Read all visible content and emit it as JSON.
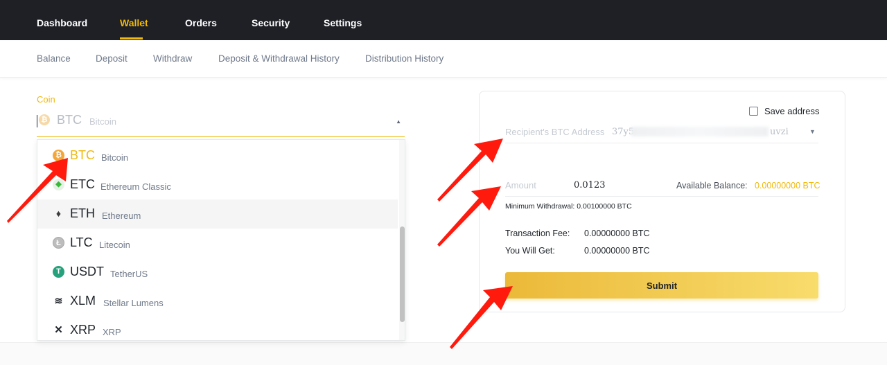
{
  "topnav": {
    "items": [
      {
        "label": "Dashboard"
      },
      {
        "label": "Wallet"
      },
      {
        "label": "Orders"
      },
      {
        "label": "Security"
      },
      {
        "label": "Settings"
      }
    ],
    "active": "Wallet"
  },
  "subnav": {
    "items": [
      {
        "label": "Balance"
      },
      {
        "label": "Deposit"
      },
      {
        "label": "Withdraw"
      },
      {
        "label": "Deposit & Withdrawal History"
      },
      {
        "label": "Distribution History"
      }
    ]
  },
  "coin_select": {
    "label": "Coin",
    "selected_symbol": "BTC",
    "selected_name": "Bitcoin",
    "selected_icon": "bitcoin-icon"
  },
  "dropdown": {
    "items": [
      {
        "symbol": "BTC",
        "name": "Bitcoin",
        "icon": "bitcoin-icon",
        "selected": true
      },
      {
        "symbol": "ETC",
        "name": "Ethereum Classic",
        "icon": "ethereum-classic-icon"
      },
      {
        "symbol": "ETH",
        "name": "Ethereum",
        "icon": "ethereum-icon",
        "hovered": true
      },
      {
        "symbol": "LTC",
        "name": "Litecoin",
        "icon": "litecoin-icon"
      },
      {
        "symbol": "USDT",
        "name": "TetherUS",
        "icon": "tether-icon"
      },
      {
        "symbol": "XLM",
        "name": "Stellar Lumens",
        "icon": "stellar-icon"
      },
      {
        "symbol": "XRP",
        "name": "XRP",
        "icon": "xrp-icon"
      }
    ]
  },
  "form": {
    "save_address": "Save address",
    "address_label": "Recipient's BTC Address",
    "address_value_start": "37y5",
    "address_value_end": "uvzi",
    "amount_label": "Amount",
    "amount_value": "0.0123",
    "available_label": "Available Balance:",
    "available_value": "0.00000000 BTC",
    "min_withdrawal": "Minimum Withdrawal: 0.00100000 BTC",
    "fee_label": "Transaction Fee:",
    "fee_value": "0.00000000 BTC",
    "get_label": "You Will Get:",
    "get_value": "0.00000000 BTC",
    "submit_label": "Submit"
  },
  "colors": {
    "accent": "#f0b90b",
    "nav_bg": "#1e2026",
    "annotation_arrow": "#ff1a0d"
  }
}
